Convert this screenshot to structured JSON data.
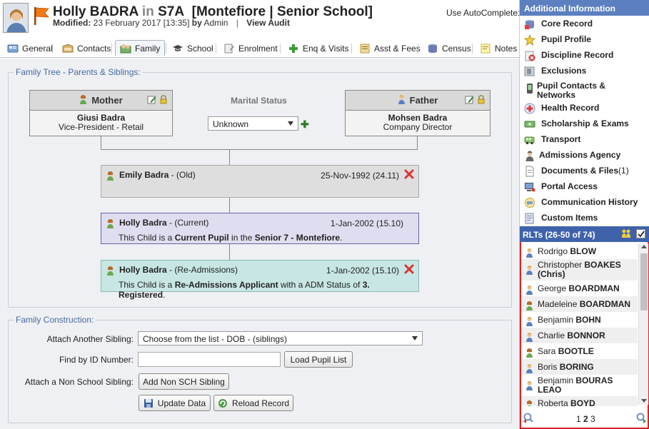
{
  "header": {
    "student_name": "Holly BADRA",
    "in_word": "in",
    "class_code": "S7A",
    "campus": "[Montefiore | Senior School]",
    "modified_label": "Modified:",
    "modified_value": "23 February 2017 [13:35]",
    "by_word": "by",
    "modified_by": "Admin",
    "view_audit": "View Audit",
    "autocomplete_label": "Use AutoComplete:"
  },
  "tabs": [
    {
      "label": "General",
      "icon": "general-icon"
    },
    {
      "label": "Contacts",
      "icon": "contacts-icon"
    },
    {
      "label": "Family",
      "icon": "family-icon",
      "active": true
    },
    {
      "label": "School",
      "icon": "school-icon"
    },
    {
      "label": "Enrolment",
      "icon": "enrolment-icon"
    },
    {
      "label": "Enq & Visits",
      "icon": "plus-icon"
    },
    {
      "label": "Asst & Fees",
      "icon": "fees-icon"
    },
    {
      "label": "Census",
      "icon": "census-icon"
    },
    {
      "label": "Notes (",
      "icon": "notes-icon"
    }
  ],
  "family_tree": {
    "legend": "Family Tree - Parents & Siblings:",
    "mother": {
      "role": "Mother",
      "name": "Giusi Badra",
      "job": "Vice-President - Retail"
    },
    "father": {
      "role": "Father",
      "name": "Mohsen Badra",
      "job": "Company Director"
    },
    "marital_label": "Marital Status",
    "marital_value": "Unknown",
    "children": [
      {
        "name": "Emily Badra",
        "status": " - (Old)",
        "date": "25-Nov-1992 (24.11)",
        "desc_parts": []
      },
      {
        "name": "Holly Badra",
        "status": " - (Current)",
        "date": "1-Jan-2002 (15.10)",
        "desc_a": "This Child is a ",
        "desc_b": "Current Pupil",
        "desc_c": " in the ",
        "desc_d": "Senior 7 - Montefiore",
        "desc_e": "."
      },
      {
        "name": "Holly Badra",
        "status": " - (Re-Admissions)",
        "date": "1-Jan-2002 (15.10)",
        "desc_a": "This Child is a ",
        "desc_b": "Re-Admissions Applicant",
        "desc_c": " with a ADM Status of ",
        "desc_d": "3. Registered",
        "desc_e": "."
      }
    ]
  },
  "family_construction": {
    "legend": "Family Construction:",
    "attach_label": "Attach Another Sibling:",
    "attach_value": "Choose from the list - DOB - (siblings)",
    "find_label": "Find by ID Number:",
    "find_value": "",
    "load_button": "Load Pupil List",
    "nonschool_label": "Attach a Non School Sibling:",
    "nonschool_button": "Add Non SCH Sibling",
    "update_button": "Update Data",
    "reload_button": "Reload Record"
  },
  "additional": {
    "title": "Additional Information",
    "items": [
      {
        "label": "Core Record",
        "icon": "core-record-icon"
      },
      {
        "label": "Pupil Profile",
        "icon": "star-icon"
      },
      {
        "label": "Discipline Record",
        "icon": "discipline-icon"
      },
      {
        "label": "Exclusions",
        "icon": "exclusions-icon"
      },
      {
        "label": "Pupil Contacts & Networks",
        "icon": "phone-icon"
      },
      {
        "label": "Health Record",
        "icon": "health-icon"
      },
      {
        "label": "Scholarship & Exams",
        "icon": "scholarship-icon"
      },
      {
        "label": "Transport",
        "icon": "bus-icon"
      },
      {
        "label": "Admissions Agency",
        "icon": "agent-icon"
      },
      {
        "label": "Documents & Files",
        "count": " (1)",
        "icon": "document-icon"
      },
      {
        "label": "Portal Access",
        "icon": "portal-icon"
      },
      {
        "label": "Communication History",
        "icon": "communication-icon"
      },
      {
        "label": "Custom Items",
        "icon": "custom-icon"
      }
    ]
  },
  "rlt": {
    "title": "RLTs (26-50 of 74)",
    "rows": [
      {
        "first": "Rodrigo",
        "last": "BLOW",
        "gender": "m"
      },
      {
        "first": "Christopher",
        "last": "BOAKES",
        "nick": "(Chris)",
        "gender": "m"
      },
      {
        "first": "George",
        "last": "BOARDMAN",
        "gender": "m"
      },
      {
        "first": "Madeleine",
        "last": "BOARDMAN",
        "gender": "f"
      },
      {
        "first": "Benjamin",
        "last": "BOHN",
        "gender": "m"
      },
      {
        "first": "Charlie",
        "last": "BONNOR",
        "gender": "m"
      },
      {
        "first": "Sara",
        "last": "BOOTLE",
        "gender": "f"
      },
      {
        "first": "Boris",
        "last": "BORING",
        "gender": "m"
      },
      {
        "first": "Benjamin",
        "last": "BOURAS LEAO",
        "gender": "m"
      },
      {
        "first": "Roberta",
        "last": "BOYD",
        "gender": "f"
      }
    ],
    "pages": [
      "1",
      "2",
      "3"
    ],
    "current_page": "2"
  },
  "colors": {
    "accent_blue": "#5b7fbf",
    "rlt_blue": "#3f62ab",
    "current_child_bg": "#dfddf0",
    "readmission_bg": "#c7e6e4",
    "delete_red": "#d33"
  }
}
